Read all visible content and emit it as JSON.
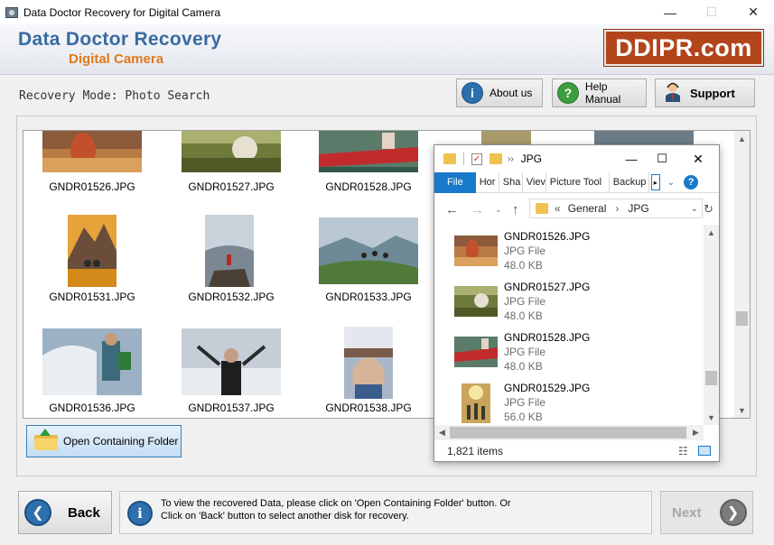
{
  "window": {
    "title": "Data Doctor Recovery for Digital Camera",
    "minimize_glyph": "—",
    "maximize_glyph": "☐",
    "close_glyph": "✕"
  },
  "header": {
    "brand_line1": "Data Doctor Recovery",
    "brand_line2": "Digital Camera",
    "logo_text": "DDIPR.com",
    "brand_color": "#3a6aa0",
    "accent_color": "#e07a1c",
    "logo_color": "#b2451c"
  },
  "mode_bar": {
    "mode_text": "Recovery Mode: Photo Search",
    "about_label": "About us",
    "help_label": "Help Manual",
    "support_label": "Support",
    "icons": [
      "info-icon",
      "help-icon",
      "support-person-icon"
    ]
  },
  "gallery": {
    "items": [
      {
        "name": "GNDR01526.JPG"
      },
      {
        "name": "GNDR01527.JPG"
      },
      {
        "name": "GNDR01528.JPG"
      },
      {
        "name": "GNDR01531.JPG"
      },
      {
        "name": "GNDR01532.JPG"
      },
      {
        "name": "GNDR01533.JPG"
      },
      {
        "name": "GNDR01536.JPG"
      },
      {
        "name": "GNDR01537.JPG"
      },
      {
        "name": "GNDR01538.JPG"
      }
    ]
  },
  "open_folder_label": "Open Containing Folder",
  "explorer": {
    "title": "JPG",
    "ribbon_tabs": [
      "File",
      "Hor",
      "Sha",
      "Viev",
      "Picture Tool",
      "Backup"
    ],
    "address_prefix": "«",
    "breadcrumb": [
      "General",
      "JPG"
    ],
    "files": [
      {
        "name": "GNDR01526.JPG",
        "type": "JPG File",
        "size": "48.0 KB"
      },
      {
        "name": "GNDR01527.JPG",
        "type": "JPG File",
        "size": "48.0 KB"
      },
      {
        "name": "GNDR01528.JPG",
        "type": "JPG File",
        "size": "48.0 KB"
      },
      {
        "name": "GNDR01529.JPG",
        "type": "JPG File",
        "size": "56.0 KB"
      }
    ],
    "item_count": "1,821 items"
  },
  "footer": {
    "back_label": "Back",
    "next_label": "Next",
    "info_line1": "To view the recovered Data, please click on 'Open Containing Folder' button. Or",
    "info_line2": "Click on 'Back' button to select another disk for recovery."
  }
}
